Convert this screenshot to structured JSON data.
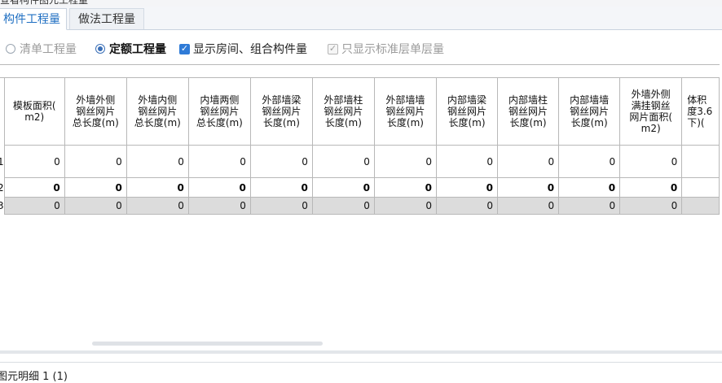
{
  "window": {
    "title": "查看构件图元工程量"
  },
  "tabs": [
    {
      "label": "构件工程量",
      "active": true
    },
    {
      "label": "做法工程量",
      "active": false
    }
  ],
  "options": {
    "radio_qingdan": {
      "label": "清单工程量",
      "checked": false
    },
    "radio_dinge": {
      "label": "定额工程量",
      "checked": true
    },
    "check_show_rooms": {
      "label": "显示房间、组合构件量",
      "checked": true
    },
    "check_standard_floor": {
      "label": "只显示标准层单层量",
      "checked": true,
      "disabled": true
    }
  },
  "table": {
    "columns": [
      "模板面积(\nm2)",
      "外墙外侧\n钢丝网片\n总长度(m)",
      "外墙内侧\n钢丝网片\n总长度(m)",
      "内墙两侧\n钢丝网片\n总长度(m)",
      "外部墙梁\n钢丝网片\n长度(m)",
      "外部墙柱\n钢丝网片\n长度(m)",
      "外部墙墙\n钢丝网片\n长度(m)",
      "内部墙梁\n钢丝网片\n长度(m)",
      "内部墙柱\n钢丝网片\n长度(m)",
      "内部墙墙\n钢丝网片\n长度(m)",
      "外墙外侧\n满挂钢丝\n网片面积(\nm2)",
      "体积\n度3.6\n下)("
    ],
    "rows": [
      {
        "marker": "1",
        "style": "normal",
        "values": [
          "0",
          "0",
          "0",
          "0",
          "0",
          "0",
          "0",
          "0",
          "0",
          "0",
          "0",
          ""
        ]
      },
      {
        "marker": "2",
        "style": "bold",
        "values": [
          "0",
          "0",
          "0",
          "0",
          "0",
          "0",
          "0",
          "0",
          "0",
          "0",
          "0",
          ""
        ]
      },
      {
        "marker": "3",
        "style": "summary",
        "values": [
          "0",
          "0",
          "0",
          "0",
          "0",
          "0",
          "0",
          "0",
          "0",
          "0",
          "0",
          ""
        ]
      }
    ]
  },
  "status": {
    "text": "图元明细  1 (1)"
  },
  "colors": {
    "accent": "#2f7bd7",
    "active_tab_text": "#1f6fc2",
    "summary_row_bg": "#dcdcdc",
    "grid_line": "#b8b8b8"
  },
  "icons": {
    "radio_on": "radio-selected-icon",
    "radio_off": "radio-unselected-icon",
    "check_on": "checkbox-checked-icon",
    "check_disabled": "checkbox-disabled-icon"
  }
}
